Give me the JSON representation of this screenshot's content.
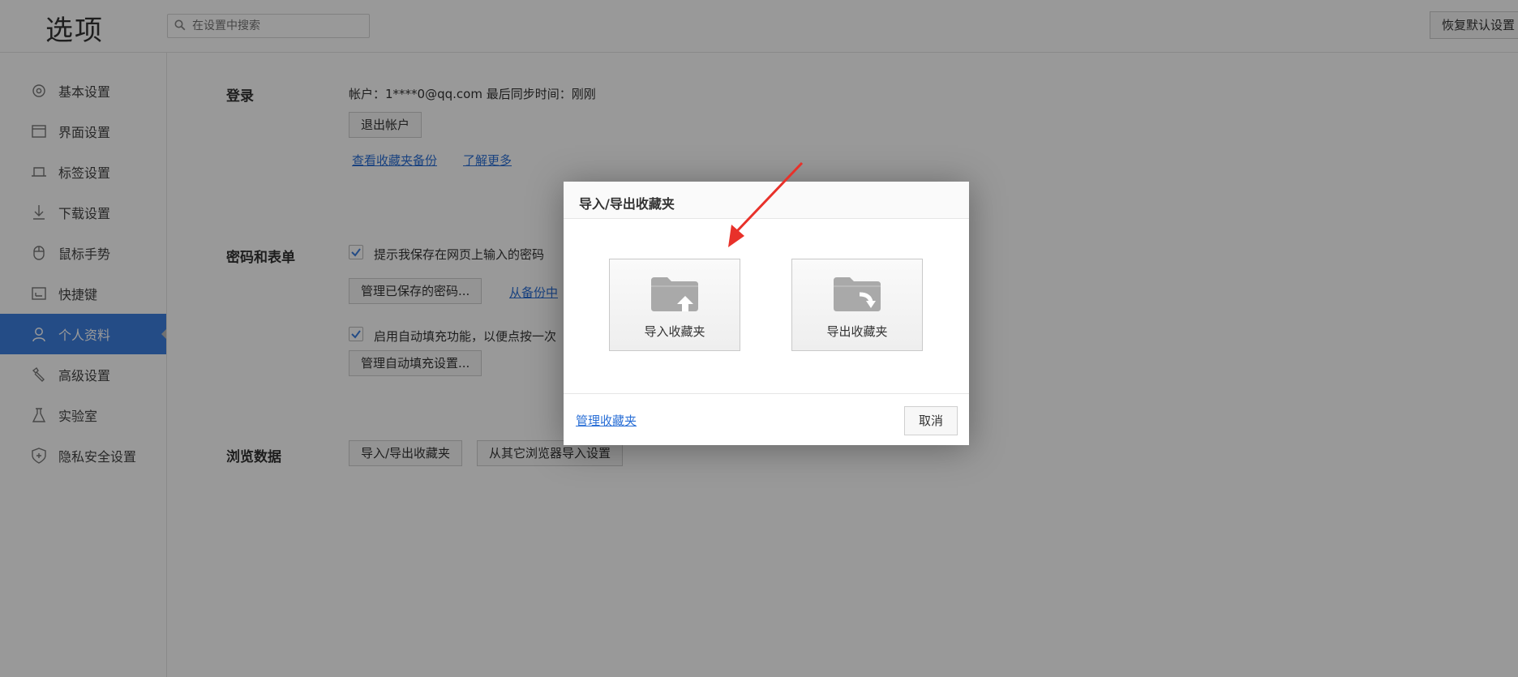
{
  "header": {
    "title": "选项",
    "search_placeholder": "在设置中搜索",
    "restore_defaults": "恢复默认设置"
  },
  "sidebar": {
    "items": [
      {
        "label": "基本设置",
        "icon": "gear-icon"
      },
      {
        "label": "界面设置",
        "icon": "window-icon"
      },
      {
        "label": "标签设置",
        "icon": "tab-icon"
      },
      {
        "label": "下载设置",
        "icon": "download-icon"
      },
      {
        "label": "鼠标手势",
        "icon": "mouse-icon"
      },
      {
        "label": "快捷键",
        "icon": "shortcut-icon"
      },
      {
        "label": "个人资料",
        "icon": "user-icon",
        "active": true
      },
      {
        "label": "高级设置",
        "icon": "wrench-icon"
      },
      {
        "label": "实验室",
        "icon": "flask-icon"
      },
      {
        "label": "隐私安全设置",
        "icon": "shield-icon"
      }
    ]
  },
  "login": {
    "title": "登录",
    "account_text": "帐户：1****0@qq.com 最后同步时间：刚刚",
    "logout_button": "退出帐户",
    "view_backup_link": "查看收藏夹备份",
    "learn_more_link": "了解更多"
  },
  "passwords": {
    "title": "密码和表单",
    "save_password_label": "提示我保存在网页上输入的密码",
    "save_password_checked": true,
    "manage_passwords_button": "管理已保存的密码...",
    "from_backup_link": "从备份中",
    "autofill_label": "启用自动填充功能，以便点按一次",
    "autofill_checked": true,
    "manage_autofill_button": "管理自动填充设置..."
  },
  "browsing_data": {
    "title": "浏览数据",
    "import_export_button": "导入/导出收藏夹",
    "import_other_button": "从其它浏览器导入设置"
  },
  "dialog": {
    "title": "导入/导出收藏夹",
    "import_label": "导入收藏夹",
    "export_label": "导出收藏夹",
    "manage_link": "管理收藏夹",
    "cancel_button": "取消"
  },
  "colors": {
    "accent": "#3d7fe0",
    "link": "#2a6fd6",
    "annotation_arrow": "#e8312a"
  }
}
